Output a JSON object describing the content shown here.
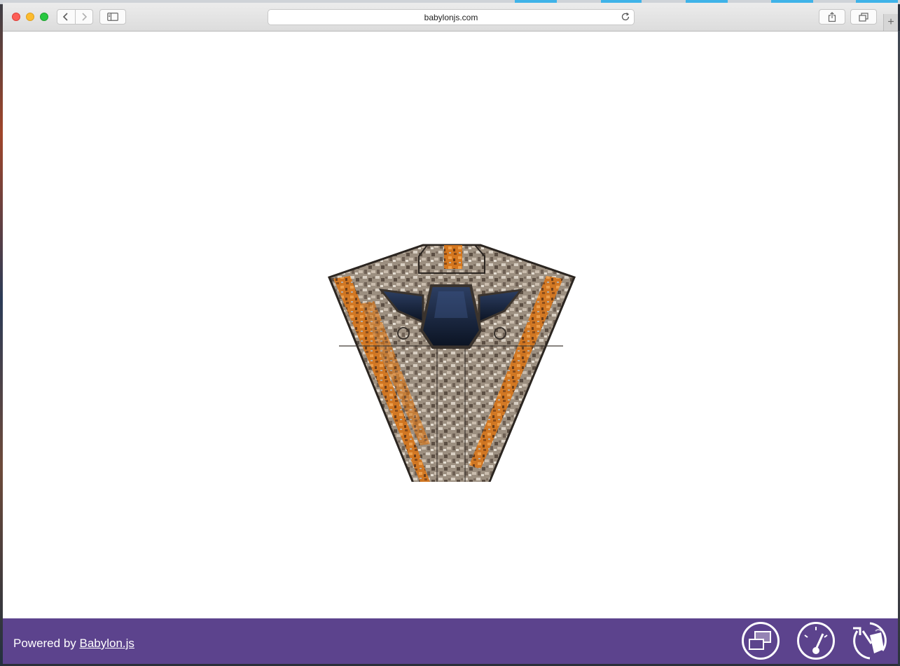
{
  "browser": {
    "url": "babylonjs.com",
    "new_tab_glyph": "+"
  },
  "icons": {
    "back": "chevron-left-icon",
    "forward": "chevron-right-icon",
    "sidebar": "sidebar-icon",
    "reload": "reload-icon",
    "share": "share-icon",
    "tabs": "tabs-overview-icon",
    "fullscreen": "fullscreen-icon",
    "performance": "speedometer-icon",
    "vr": "vr-icon"
  },
  "footer": {
    "powered_prefix": "Powered by ",
    "powered_link": "Babylon.js"
  },
  "colors": {
    "footer_bg": "#5c438d",
    "toolbar_bg": "#e4e4e4",
    "accent_orange": "#e07a1f"
  }
}
